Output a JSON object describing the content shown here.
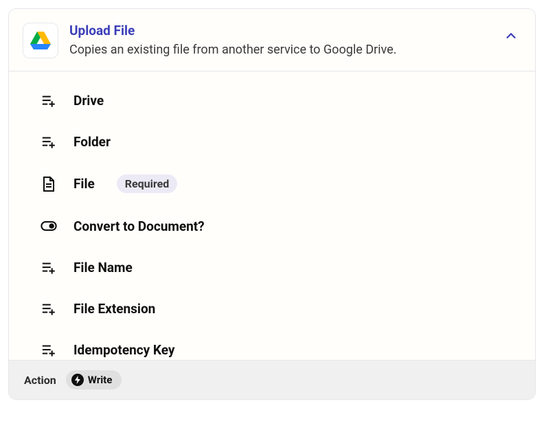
{
  "header": {
    "title": "Upload File",
    "description": "Copies an existing file from another service to Google Drive."
  },
  "fields": [
    {
      "label": "Drive",
      "icon": "list-add",
      "required": false
    },
    {
      "label": "Folder",
      "icon": "list-add",
      "required": false
    },
    {
      "label": "File",
      "icon": "file",
      "required": true
    },
    {
      "label": "Convert to Document?",
      "icon": "toggle",
      "required": false
    },
    {
      "label": "File Name",
      "icon": "list-add",
      "required": false
    },
    {
      "label": "File Extension",
      "icon": "list-add",
      "required": false
    },
    {
      "label": "Idempotency Key",
      "icon": "list-add",
      "required": false
    }
  ],
  "badges": {
    "required": "Required"
  },
  "footer": {
    "action_label": "Action",
    "write_label": "Write"
  }
}
